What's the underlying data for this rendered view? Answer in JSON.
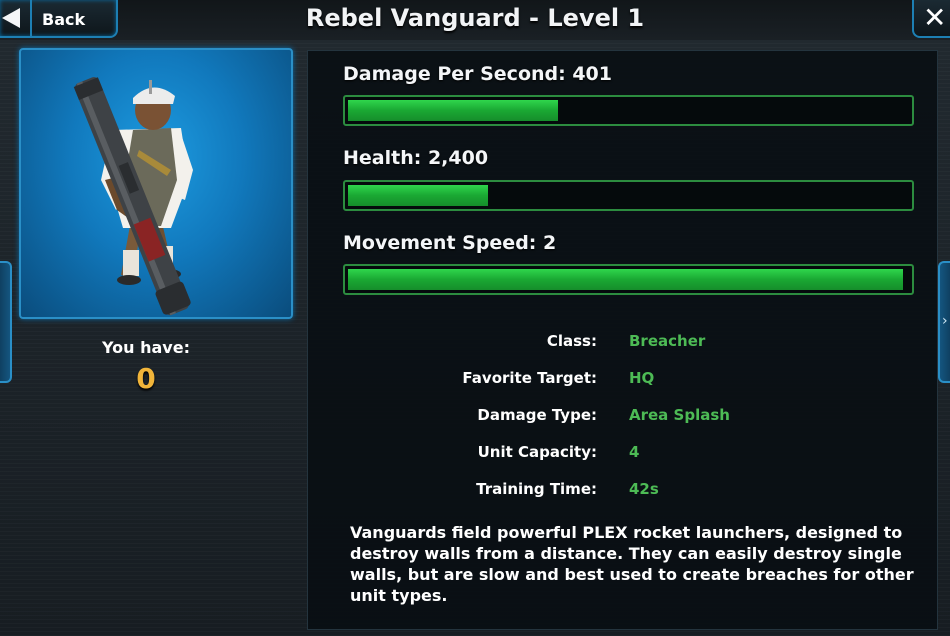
{
  "header": {
    "title": "Rebel Vanguard - Level 1",
    "back_label": "Back",
    "close_icon": "close-icon",
    "back_icon": "back-arrow-icon"
  },
  "unit": {
    "portrait_icon": "rebel-vanguard-portrait",
    "owned_label": "You have:",
    "owned_count": "0"
  },
  "stats": [
    {
      "label": "Damage Per Second: 401",
      "fill_fraction": 0.375
    },
    {
      "label": "Health: 2,400",
      "fill_fraction": 0.25
    },
    {
      "label": "Movement Speed: 2",
      "fill_fraction": 0.99
    }
  ],
  "details": [
    {
      "key": "Class:",
      "value": "Breacher"
    },
    {
      "key": "Favorite Target:",
      "value": "HQ"
    },
    {
      "key": "Damage Type:",
      "value": "Area Splash"
    },
    {
      "key": "Unit Capacity:",
      "value": "4"
    },
    {
      "key": "Training Time:",
      "value": "42s"
    }
  ],
  "description": "Vanguards field powerful PLEX rocket launchers, designed to destroy walls from a distance. They can easily destroy single walls, but are slow and best used to create breaches for other unit types.",
  "colors": {
    "accent": "#2a8fc7",
    "bar_green": "#1aa833",
    "value_green": "#4dbb55",
    "count_gold": "#f1b53a"
  }
}
